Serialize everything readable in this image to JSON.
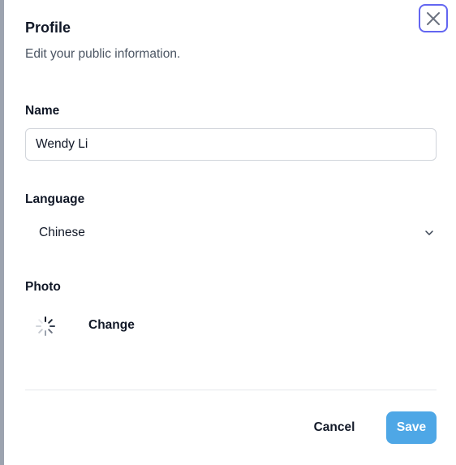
{
  "dialog": {
    "title": "Profile",
    "subtitle": "Edit your public information."
  },
  "name_field": {
    "label": "Name",
    "value": "Wendy Li"
  },
  "language_field": {
    "label": "Language",
    "selected": "Chinese",
    "icon": "chevron-down-icon"
  },
  "photo_field": {
    "label": "Photo",
    "change_label": "Change",
    "loading_icon": "spinner-icon"
  },
  "footer": {
    "cancel_label": "Cancel",
    "save_label": "Save"
  },
  "colors": {
    "focus_ring": "#6366f1",
    "save_button": "#4ea7e6",
    "text_primary": "#111827",
    "text_secondary": "#4b5563",
    "border": "#d1d5db"
  }
}
